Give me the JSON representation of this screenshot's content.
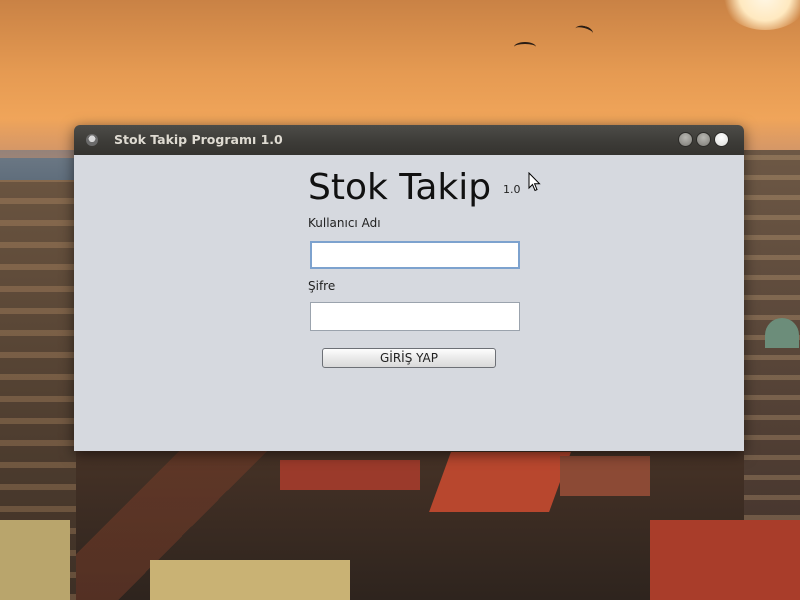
{
  "window": {
    "title": "Stok Takip Programı 1.0"
  },
  "login": {
    "heading": "Stok Takip",
    "version": "1.0",
    "username_label": "Kullanıcı Adı",
    "username_value": "",
    "password_label": "Şifre",
    "password_value": "",
    "submit_label": "GİRİŞ YAP"
  },
  "colors": {
    "content_bg": "#d6d9df",
    "titlebar_bg": "#3d3c38",
    "focus_border": "#7da2ce"
  },
  "icons": {
    "app": "app-icon",
    "minimize": "minimize-icon",
    "maximize": "maximize-icon",
    "close": "close-icon",
    "pointer": "mouse-pointer-icon"
  }
}
